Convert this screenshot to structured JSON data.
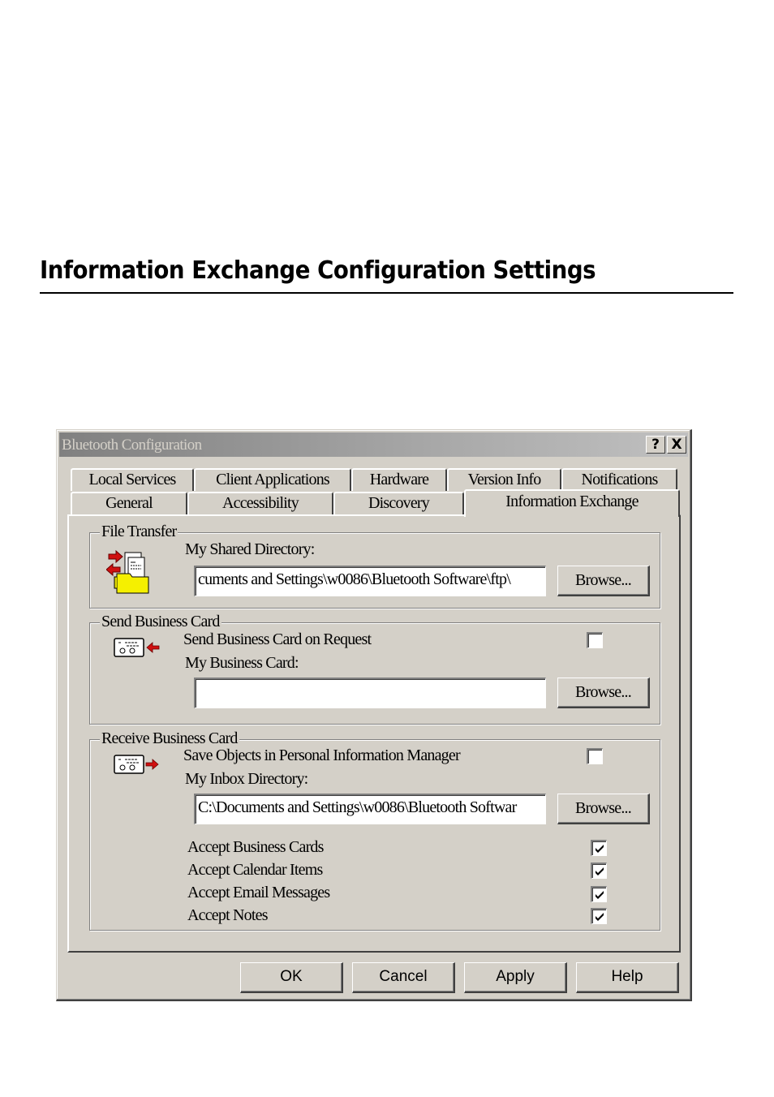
{
  "page": {
    "heading": "Information Exchange Configuration Settings"
  },
  "dialog": {
    "title": "Bluetooth Configuration",
    "help_button": "?",
    "close_button": "X",
    "tabs_back_row": [
      {
        "label": "Local Services"
      },
      {
        "label": "Client Applications"
      },
      {
        "label": "Hardware"
      },
      {
        "label": "Version Info"
      },
      {
        "label": "Notifications"
      }
    ],
    "tabs_front_row": [
      {
        "label": "General"
      },
      {
        "label": "Accessibility"
      },
      {
        "label": "Discovery"
      },
      {
        "label": "Information Exchange",
        "active": true
      }
    ],
    "file_transfer": {
      "group_label": "File Transfer",
      "icon": "file-transfer-folder-icon",
      "shared_dir_label": "My Shared Directory:",
      "shared_dir_value": "cuments and Settings\\w0086\\Bluetooth Software\\ftp\\",
      "browse_label": "Browse..."
    },
    "send_business_card": {
      "group_label": "Send Business Card",
      "icon": "send-business-card-icon",
      "on_request_label": "Send Business Card on Request",
      "on_request_checked": false,
      "my_card_label": "My Business Card:",
      "my_card_value": "",
      "browse_label": "Browse..."
    },
    "receive_business_card": {
      "group_label": "Receive Business Card",
      "icon": "receive-business-card-icon",
      "save_pim_label": "Save Objects in Personal Information Manager",
      "save_pim_checked": false,
      "inbox_label": "My Inbox Directory:",
      "inbox_value": "C:\\Documents and Settings\\w0086\\Bluetooth Softwar",
      "browse_label": "Browse...",
      "accept_options": [
        {
          "label": "Accept Business Cards",
          "checked": true
        },
        {
          "label": "Accept Calendar Items",
          "checked": true
        },
        {
          "label": "Accept Email Messages",
          "checked": true
        },
        {
          "label": "Accept Notes",
          "checked": true
        }
      ]
    },
    "footer_buttons": {
      "ok": "OK",
      "cancel": "Cancel",
      "apply": "Apply",
      "help": "Help"
    }
  }
}
